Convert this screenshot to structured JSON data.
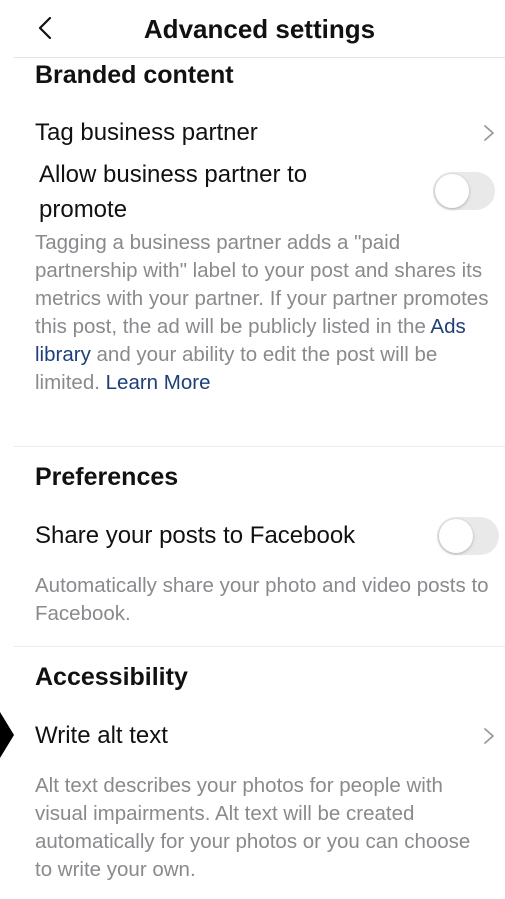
{
  "header": {
    "title": "Advanced settings",
    "back_icon": "chevron-left-icon"
  },
  "branded_content": {
    "title": "Branded content",
    "tag_partner_label": "Tag business partner",
    "allow_promote_label": "Allow business partner to promote",
    "allow_promote_enabled": false,
    "description_part1": "Tagging a business partner adds a \"paid partnership with\" label to your post and shares its metrics with your partner. If your partner promotes this post, the ad will be publicly listed in the ",
    "ads_library_link": "Ads library",
    "description_part2": " and your ability to edit the post will be limited. ",
    "learn_more_link": "Learn More"
  },
  "preferences": {
    "title": "Preferences",
    "share_facebook_label": "Share your posts to Facebook",
    "share_facebook_enabled": false,
    "description": "Automatically share your photo and video posts to Facebook."
  },
  "accessibility": {
    "title": "Accessibility",
    "alt_text_label": "Write alt text",
    "description": "Alt text describes your photos for people with visual impairments. Alt text will be created automatically for your photos or you can choose to write your own."
  },
  "colors": {
    "text": "#111111",
    "secondary_text": "#8a8a8e",
    "link": "#1d3f7a",
    "toggle_off": "#e9e9ea"
  }
}
